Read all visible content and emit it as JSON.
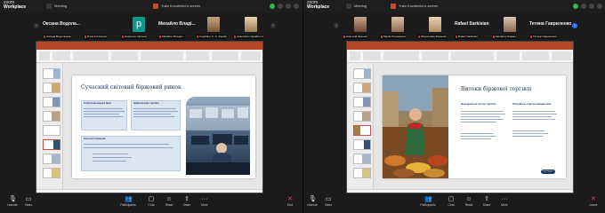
{
  "app": {
    "brand_line1": "zoom",
    "brand_line2": "Workplace"
  },
  "left": {
    "tabs": [
      {
        "label": "Meeting",
        "icon": "meeting-icon"
      },
      {
        "label": "Yulia Kovalenko's screen",
        "icon": "screen-share-icon"
      }
    ],
    "strip": {
      "names": [
        "Оксана Водола...",
        "Михайло Владі..."
      ],
      "labels": [
        "Оксана Водолазька",
        "Dima Kovtonyuk",
        "Нарпатко Хірська",
        "Михайло Владич...",
        "Сарабюл С. О. Харків",
        "Анастасія Сарабюл С."
      ]
    },
    "slide": {
      "title": "Сучасний світовий біржовий ринок",
      "boxes": [
        "Глобальна мережа бірж",
        "Цифровізація торгівлі",
        "Ключові показники"
      ]
    },
    "controls": [
      "Unmute",
      "Video",
      "Participants",
      "Chat",
      "React",
      "Share",
      "More",
      "End"
    ]
  },
  "right": {
    "tabs": [
      {
        "label": "Meeting",
        "icon": "meeting-icon"
      },
      {
        "label": "Yulia Kovalenko's screen",
        "icon": "screen-share-icon"
      }
    ],
    "strip": {
      "names": [
        "Rafael Sarkisian",
        "Тетяна Гавриленко"
      ],
      "labels": [
        "Анатолій Зелена",
        "Марія Гончаренко",
        "Мирослава Фоменко",
        "Rafael Sarkisian",
        "Михайло Ромаш",
        "Тетяна Гавриленко"
      ]
    },
    "slide": {
      "title": "Витоки біржової торгівлі",
      "col1": "Венеціанські оптові торгівлі",
      "col2": "Ганзейські торгові майданчики",
      "button": "Перехід до..."
    },
    "controls": [
      "Unmute",
      "Video",
      "Participants",
      "Chat",
      "React",
      "Share",
      "More",
      "Leave"
    ]
  },
  "colors": {
    "ppt_red": "#b7472a",
    "slide_navy": "#1f3864",
    "end_red": "#e54545",
    "zoom_blue": "#2d6cf5"
  }
}
